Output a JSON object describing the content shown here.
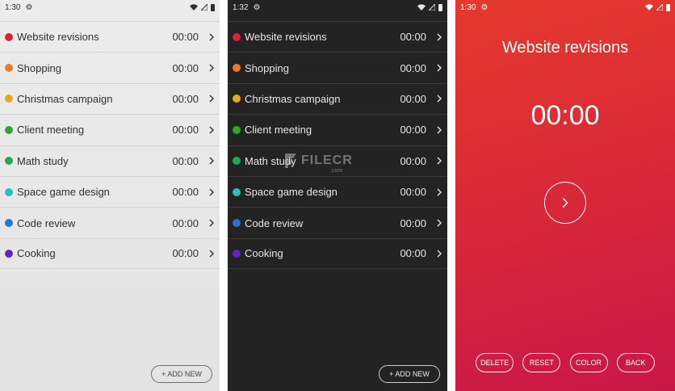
{
  "colors": {
    "red": "#d72638",
    "orange": "#ee7a22",
    "yellow": "#e4aa1f",
    "green": "#33a532",
    "green2": "#1fa85a",
    "teal": "#26c2b5",
    "blue": "#2176d9",
    "purple": "#6620c8"
  },
  "light": {
    "status": {
      "time": "1:30"
    },
    "tasks": [
      {
        "name": "Website revisions",
        "time": "00:00",
        "color": "#d72638"
      },
      {
        "name": "Shopping",
        "time": "00:00",
        "color": "#ee7a22"
      },
      {
        "name": "Christmas campaign",
        "time": "00:00",
        "color": "#e4aa1f"
      },
      {
        "name": "Client meeting",
        "time": "00:00",
        "color": "#33a532"
      },
      {
        "name": "Math study",
        "time": "00:00",
        "color": "#1fa85a"
      },
      {
        "name": "Space game design",
        "time": "00:00",
        "color": "#26c2b5"
      },
      {
        "name": "Code review",
        "time": "00:00",
        "color": "#2176d9"
      },
      {
        "name": "Cooking",
        "time": "00:00",
        "color": "#6620c8"
      }
    ],
    "add_new_label": "+ ADD NEW"
  },
  "dark": {
    "status": {
      "time": "1:32"
    },
    "tasks": [
      {
        "name": "Website revisions",
        "time": "00:00",
        "color": "#d72638"
      },
      {
        "name": "Shopping",
        "time": "00:00",
        "color": "#ee7a22"
      },
      {
        "name": "Christmas campaign",
        "time": "00:00",
        "color": "#e4aa1f"
      },
      {
        "name": "Client meeting",
        "time": "00:00",
        "color": "#33a532"
      },
      {
        "name": "Math study",
        "time": "00:00",
        "color": "#1fa85a"
      },
      {
        "name": "Space game design",
        "time": "00:00",
        "color": "#26c2b5"
      },
      {
        "name": "Code review",
        "time": "00:00",
        "color": "#2176d9"
      },
      {
        "name": "Cooking",
        "time": "00:00",
        "color": "#6620c8"
      }
    ],
    "add_new_label": "+ ADD NEW"
  },
  "detail": {
    "status": {
      "time": "1:30"
    },
    "title": "Website revisions",
    "time": "00:00",
    "actions": [
      "DELETE",
      "RESET",
      "COLOR",
      "BACK"
    ]
  },
  "watermark": {
    "text": "FILECR",
    "sub": ".com"
  }
}
